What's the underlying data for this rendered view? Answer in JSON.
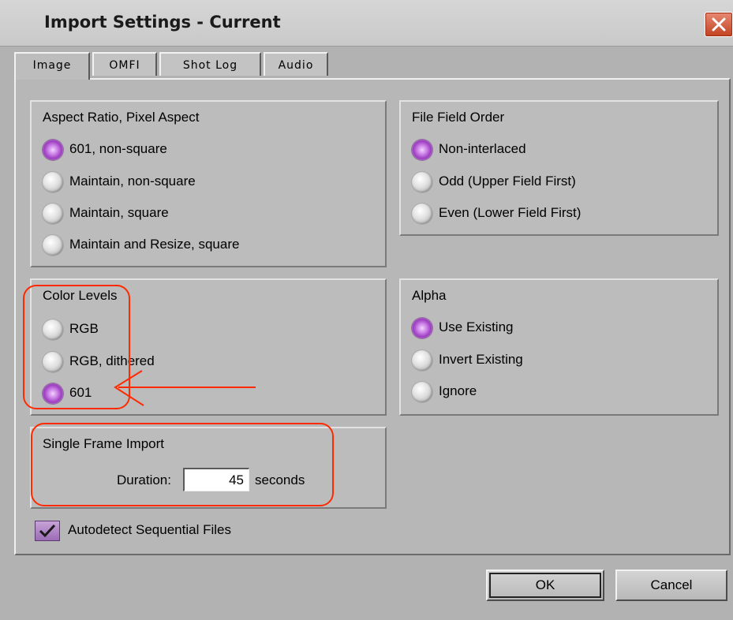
{
  "window": {
    "title": "Import Settings - Current"
  },
  "tabs": [
    {
      "label": "Image",
      "active": true
    },
    {
      "label": "OMFI",
      "active": false
    },
    {
      "label": "Shot Log",
      "active": false
    },
    {
      "label": "Audio",
      "active": false
    }
  ],
  "aspect_ratio": {
    "title": "Aspect Ratio, Pixel Aspect",
    "options": [
      {
        "label": "601, non-square",
        "selected": true
      },
      {
        "label": "Maintain, non-square",
        "selected": false
      },
      {
        "label": "Maintain, square",
        "selected": false
      },
      {
        "label": "Maintain and Resize, square",
        "selected": false
      }
    ]
  },
  "field_order": {
    "title": "File Field Order",
    "options": [
      {
        "label": "Non-interlaced",
        "selected": true
      },
      {
        "label": "Odd (Upper Field First)",
        "selected": false
      },
      {
        "label": "Even (Lower Field First)",
        "selected": false
      }
    ]
  },
  "color_levels": {
    "title": "Color Levels",
    "options": [
      {
        "label": "RGB",
        "selected": false
      },
      {
        "label": "RGB, dithered",
        "selected": false
      },
      {
        "label": "601",
        "selected": true
      }
    ]
  },
  "alpha": {
    "title": "Alpha",
    "options": [
      {
        "label": "Use Existing",
        "selected": true
      },
      {
        "label": "Invert Existing",
        "selected": false
      },
      {
        "label": "Ignore",
        "selected": false
      }
    ]
  },
  "single_frame": {
    "title": "Single Frame Import",
    "duration_label": "Duration:",
    "duration_value": "45",
    "units": "seconds"
  },
  "autodetect": {
    "label": "Autodetect Sequential Files",
    "checked": true
  },
  "buttons": {
    "ok": "OK",
    "cancel": "Cancel"
  },
  "colors": {
    "annotation": "#ff2a00",
    "radio_selected": "#b160d3",
    "close_button": "#d4532f"
  },
  "icons": {
    "close": "close-icon",
    "check": "checkmark-icon"
  }
}
